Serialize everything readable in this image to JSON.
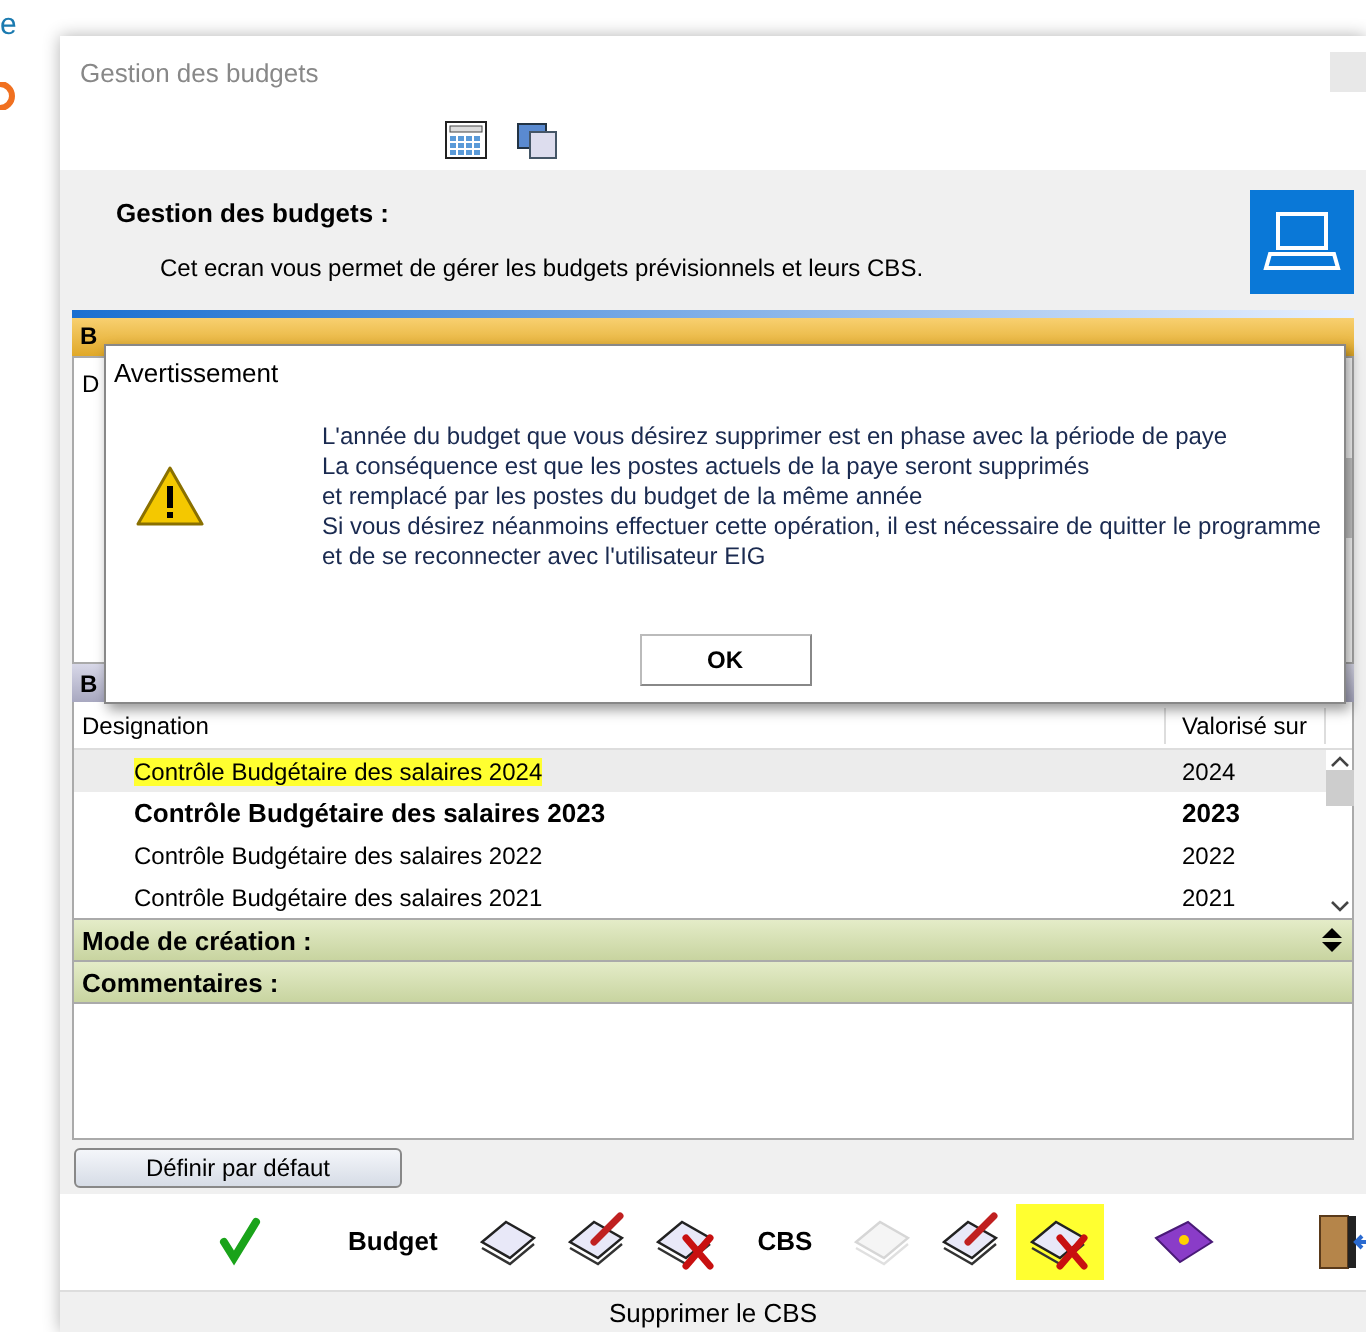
{
  "background_fragment": "e",
  "window": {
    "title": "Gestion des budgets"
  },
  "header": {
    "title": "Gestion des budgets :",
    "description": "Cet ecran vous permet de gérer les budgets prévisionnels et leurs CBS."
  },
  "section_previsionnels": {
    "title_fragment": "B",
    "column_fragment": "D"
  },
  "section_budgets": {
    "title_fragment": "B"
  },
  "dialog": {
    "title": "Avertissement",
    "lines": [
      "L'année du budget que vous désirez supprimer est en phase avec la période de paye",
      "La conséquence est que les postes actuels de la paye seront supprimés",
      "et remplacé par les postes du budget de la même année",
      "Si vous désirez néanmoins effectuer cette opération, il est nécessaire de quitter le programme",
      "et de se reconnecter avec l'utilisateur EIG"
    ],
    "button": "OK"
  },
  "table": {
    "columns": [
      "Designation",
      "Valorisé sur"
    ],
    "rows": [
      {
        "designation": "Contrôle Budgétaire des salaires 2024",
        "year": "2024",
        "selected": true,
        "default": false,
        "highlighted": true
      },
      {
        "designation": "Contrôle Budgétaire des salaires 2023",
        "year": "2023",
        "selected": false,
        "default": true,
        "highlighted": false
      },
      {
        "designation": "Contrôle Budgétaire des salaires 2022",
        "year": "2022",
        "selected": false,
        "default": false,
        "highlighted": false
      },
      {
        "designation": "Contrôle Budgétaire des salaires 2021",
        "year": "2021",
        "selected": false,
        "default": false,
        "highlighted": false
      }
    ]
  },
  "mode_section": {
    "title": "Mode de création :",
    "expanded": false
  },
  "comments_section": {
    "title": "Commentaires :"
  },
  "default_button": "Définir par défaut",
  "toolbar": [
    {
      "kind": "check",
      "disabled": false,
      "highlighted": false
    },
    {
      "kind": "label",
      "text": "Budget"
    },
    {
      "kind": "new",
      "disabled": false,
      "highlighted": false
    },
    {
      "kind": "edit",
      "disabled": false,
      "highlighted": false
    },
    {
      "kind": "delete",
      "disabled": false,
      "highlighted": false
    },
    {
      "kind": "label",
      "text": "CBS"
    },
    {
      "kind": "new",
      "disabled": true,
      "highlighted": false
    },
    {
      "kind": "edit",
      "disabled": false,
      "highlighted": false
    },
    {
      "kind": "delete",
      "disabled": false,
      "highlighted": true
    },
    {
      "kind": "help",
      "disabled": false,
      "highlighted": false
    },
    {
      "kind": "exit",
      "disabled": false,
      "highlighted": false
    }
  ],
  "status_bar": "Supprimer le CBS"
}
